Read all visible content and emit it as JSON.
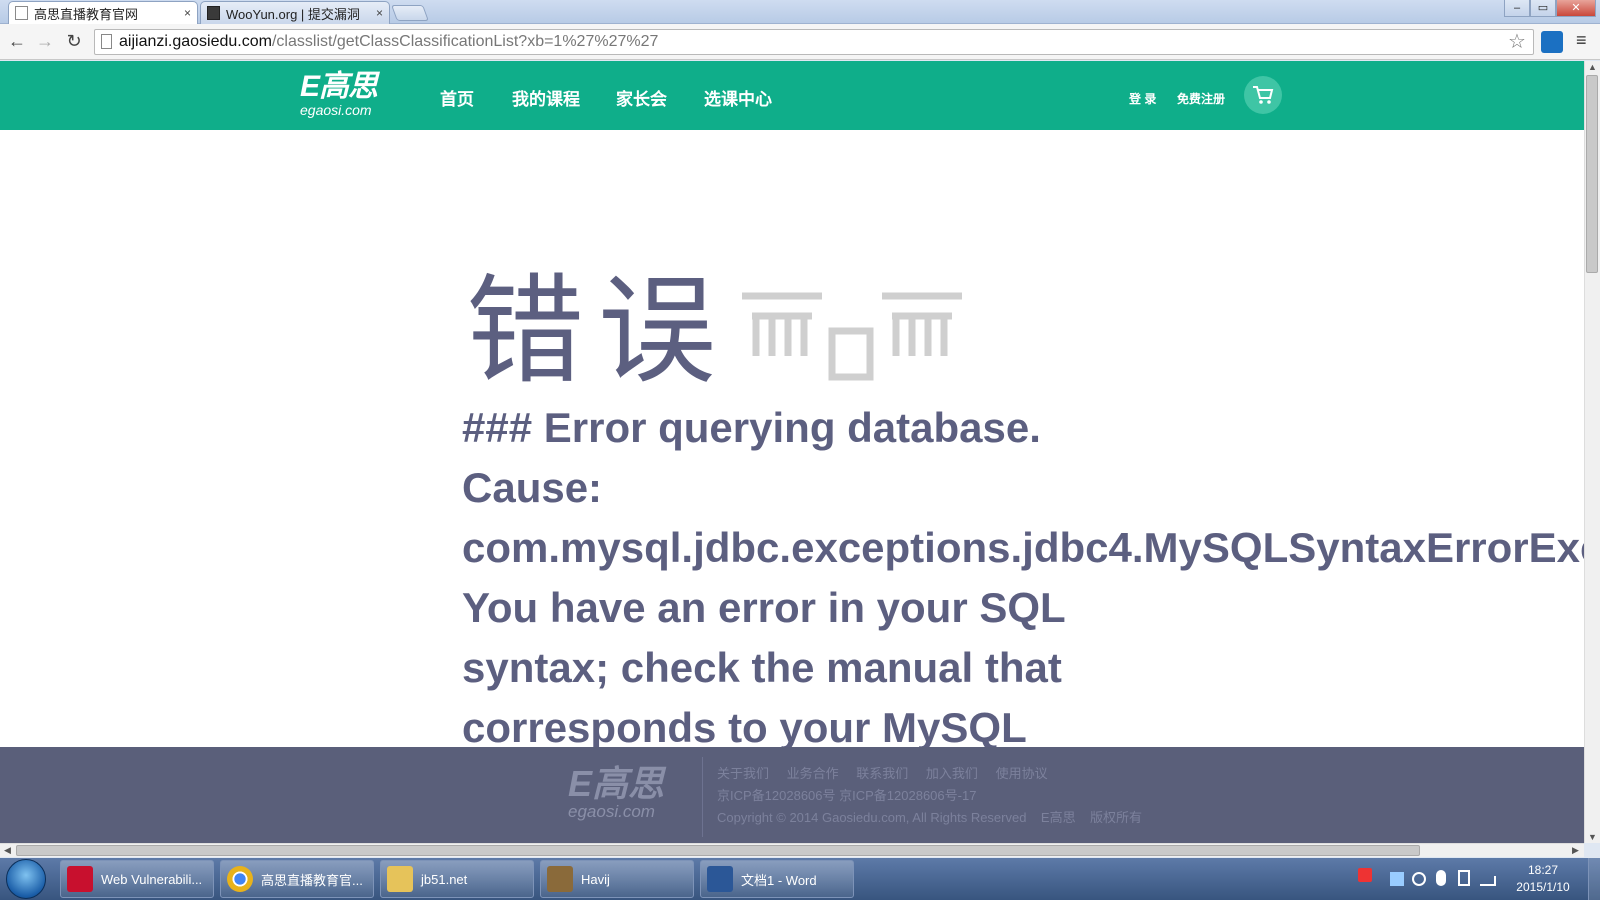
{
  "browser": {
    "tabs": [
      {
        "title": "高思直播教育官网",
        "close": "×"
      },
      {
        "title": "WooYun.org | 提交漏洞",
        "close": "×"
      }
    ],
    "window_buttons": {
      "minimize": "–",
      "maximize": "▭",
      "close": "✕"
    },
    "nav": {
      "back": "←",
      "forward": "→",
      "reload": "↻",
      "star": "☆",
      "menu": "≡"
    },
    "url": {
      "host": "aijianzi.gaosiedu.com",
      "path": "/classlist/getClassClassificationList?xb=1%27%27%27"
    }
  },
  "site": {
    "logo": {
      "big": "E高思",
      "small": "egaosi.com"
    },
    "nav": [
      "首页",
      "我的课程",
      "家长会",
      "选课中心"
    ],
    "login": "登 录",
    "register": "免费注册",
    "accent": "#0fae8a"
  },
  "error": {
    "title": "错误",
    "body": "### Error querying database.\nCause:\ncom.mysql.jdbc.exceptions.jdbc4.MySQLSyntaxErrorExc\nYou have an error in your SQL\nsyntax; check the manual that\ncorresponds to your MySQL"
  },
  "footer": {
    "logo": {
      "big": "E高思",
      "small": "egaosi.com"
    },
    "links": [
      "关于我们",
      "业务合作",
      "联系我们",
      "加入我们",
      "使用协议"
    ],
    "icp": "京ICP备12028606号 京ICP备12028606号-17",
    "copyright": "Copyright © 2014 Gaosiedu.com, All Rights Reserved    E高思    版权所有"
  },
  "taskbar": {
    "items": [
      {
        "label": "Web Vulnerabili...",
        "color": "#c8102e"
      },
      {
        "label": "高思直播教育官...",
        "color": "#e8b21b"
      },
      {
        "label": "jb51.net",
        "color": "#e6c35a"
      },
      {
        "label": "Havij",
        "color": "#8a6a3a"
      },
      {
        "label": "文档1 - Word",
        "color": "#2b5797"
      }
    ],
    "time": "18:27",
    "date": "2015/1/10"
  }
}
